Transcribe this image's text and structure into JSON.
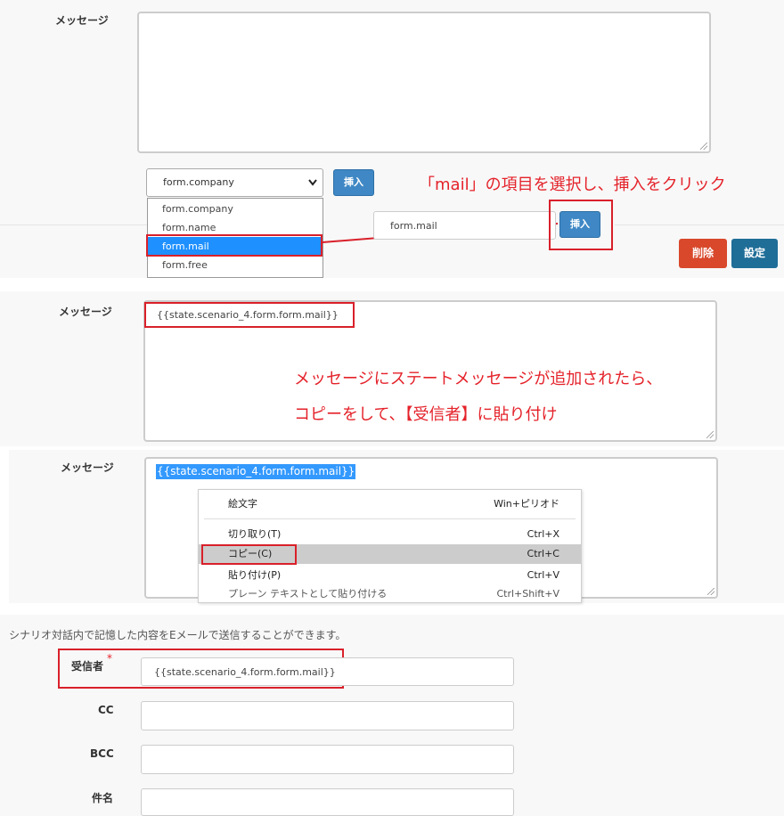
{
  "section1": {
    "message_label": "メッセージ",
    "select_value": "form.company",
    "insert_label": "挿入",
    "dropdown_options": [
      "form.company",
      "form.name",
      "form.mail",
      "form.free"
    ],
    "zoom_field_value": "form.mail",
    "zoom_insert_label": "挿入",
    "annotation": "「mail」の項目を選択し、挿入をクリック",
    "delete_label": "削除",
    "settings_label": "設定"
  },
  "section2": {
    "message_label": "メッセージ",
    "message_value": "{{state.scenario_4.form.form.mail}}",
    "annotation_line1": "メッセージにステートメッセージが追加されたら、",
    "annotation_line2": "コピーをして、【受信者】に貼り付け"
  },
  "section3": {
    "message_label": "メッセージ",
    "selected_text": "{{state.scenario_4.form.form.mail}}",
    "context_menu": [
      {
        "label": "絵文字",
        "shortcut": "Win+ピリオド"
      },
      {
        "label": "切り取り(T)",
        "shortcut": "Ctrl+X"
      },
      {
        "label": "コピー(C)",
        "shortcut": "Ctrl+C"
      },
      {
        "label": "貼り付け(P)",
        "shortcut": "Ctrl+V"
      },
      {
        "label": "プレーン テキストとして貼り付ける",
        "shortcut": "Ctrl+Shift+V"
      }
    ]
  },
  "section4": {
    "description": "シナリオ対話内で記憶した内容をEメールで送信することができます。",
    "recipient_label": "受信者",
    "required_mark": "*",
    "recipient_value": "{{state.scenario_4.form.form.mail}}",
    "cc_label": "CC",
    "bcc_label": "BCC",
    "subject_label": "件名"
  },
  "colors": {
    "annotation_red": "#e4222a",
    "insert_blue": "#3f88c5",
    "delete_orange": "#d9482b",
    "settings_blue": "#1f6e98",
    "selection_blue": "#3399ff"
  }
}
